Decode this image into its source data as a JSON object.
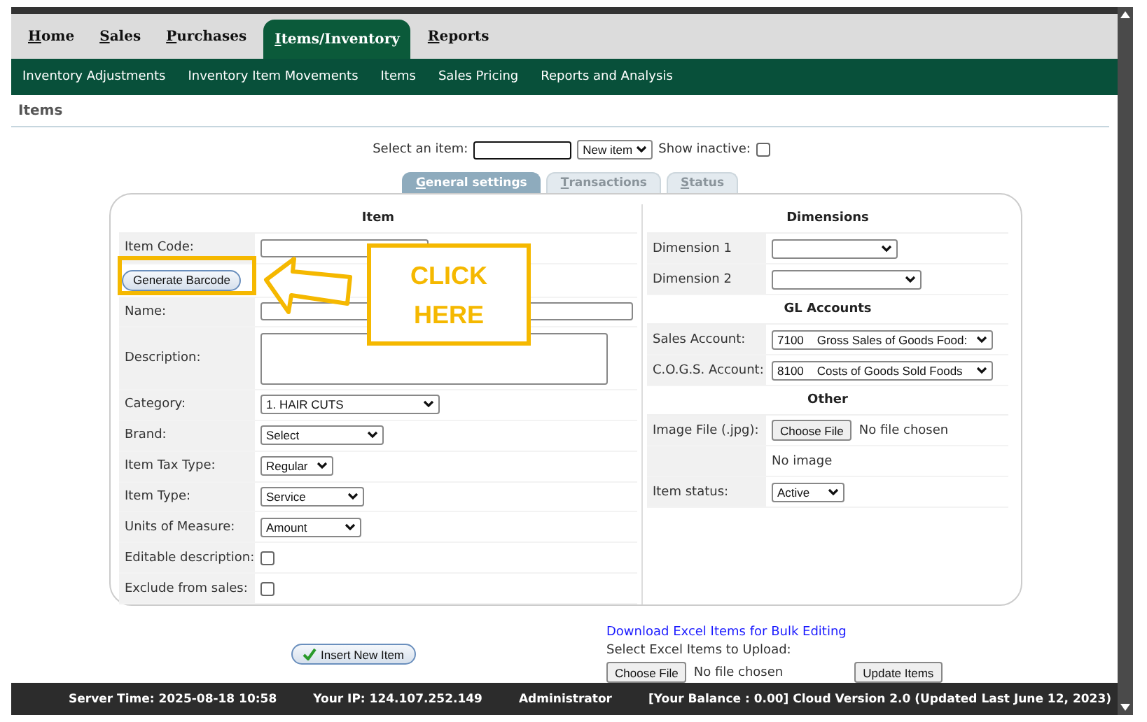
{
  "nav": {
    "tabs": [
      {
        "label": "Home",
        "selected": false
      },
      {
        "label": "Sales",
        "selected": false
      },
      {
        "label": "Purchases",
        "selected": false
      },
      {
        "label": "Items/Inventory",
        "selected": true
      },
      {
        "label": "Reports",
        "selected": false
      }
    ]
  },
  "submenu": [
    "Inventory Adjustments",
    "Inventory Item Movements",
    "Items",
    "Sales Pricing",
    "Reports and Analysis"
  ],
  "page_title": "Items",
  "selector": {
    "label": "Select an item:",
    "new_item": "New item",
    "show_inactive_label": "Show inactive:",
    "show_inactive": false
  },
  "form_tabs": [
    {
      "label": "General settings",
      "selected": true
    },
    {
      "label": "Transactions",
      "selected": false
    },
    {
      "label": "Status",
      "selected": false
    }
  ],
  "item_section": {
    "title": "Item",
    "rows": [
      {
        "kind": "text",
        "label": "Item Code:"
      },
      {
        "kind": "button",
        "label": "Generate Barcode"
      },
      {
        "kind": "text",
        "label": "Name:"
      },
      {
        "kind": "textarea",
        "label": "Description:"
      },
      {
        "kind": "select",
        "label": "Category:",
        "value": "1. HAIR CUTS"
      },
      {
        "kind": "select",
        "label": "Brand:",
        "value": "Select"
      },
      {
        "kind": "select",
        "label": "Item Tax Type:",
        "value": "Regular"
      },
      {
        "kind": "select",
        "label": "Item Type:",
        "value": "Service"
      },
      {
        "kind": "select",
        "label": "Units of Measure:",
        "value": "Amount"
      },
      {
        "kind": "checkbox",
        "label": "Editable description:",
        "checked": false
      },
      {
        "kind": "checkbox",
        "label": "Exclude from sales:",
        "checked": false
      }
    ]
  },
  "side_sections": [
    {
      "title": "Dimensions",
      "rows": [
        {
          "kind": "select",
          "label": "Dimension 1"
        },
        {
          "kind": "select",
          "label": "Dimension 2"
        }
      ]
    },
    {
      "title": "GL Accounts",
      "rows": [
        {
          "kind": "select",
          "label": "Sales Account:",
          "value": "7100    Gross Sales of Goods Food:"
        },
        {
          "kind": "select",
          "label": "C.O.G.S. Account:",
          "value": "8100    Costs of Goods Sold Foods"
        }
      ]
    },
    {
      "title": "Other",
      "rows": [
        {
          "kind": "file",
          "label": "Image File (.jpg):",
          "button": "Choose File",
          "status": "No file chosen"
        },
        {
          "kind": "note",
          "value": "No image"
        },
        {
          "kind": "select",
          "label": "Item status:",
          "value": "Active"
        }
      ]
    }
  ],
  "callout": {
    "text": "CLICK HERE"
  },
  "insert_button": "Insert New Item",
  "bulk": {
    "link": "Download Excel Items for Bulk Editing",
    "upload_label": "Select Excel Items to Upload:",
    "choose_file": "Choose File",
    "file_status": "No file chosen",
    "update_button": "Update Items"
  },
  "footer": [
    "Server Time: 2025-08-18 10:58",
    "Your IP: 124.107.252.149",
    "Administrator",
    "[Your Balance : 0.00] Cloud Version 2.0 (Updated Last June 12, 2023)"
  ]
}
